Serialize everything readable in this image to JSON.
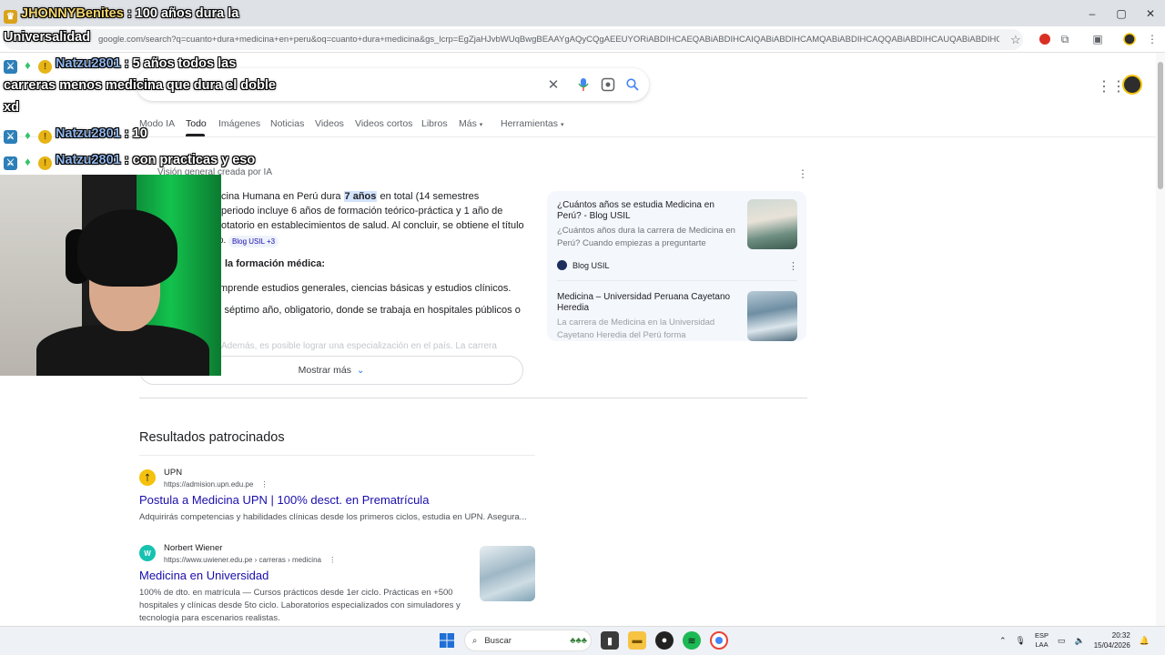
{
  "browser": {
    "url": "google.com/search?q=cuanto+dura+medicina+en+peru&oq=cuanto+dura+medicina&gs_lcrp=EgZjaHJvbWUqBwgBEAAYgAQyCQgAEEUYORiABDIHCAEQABiABDIHCAIQABiABDIHCAMQABiABDIHCAQQABiABDIHCAUQABiABDIHCAYQABiA...",
    "window_controls": [
      "–",
      "▢",
      "✕"
    ]
  },
  "google": {
    "tabs": [
      {
        "label": "Modo IA",
        "active": false
      },
      {
        "label": "Todo",
        "active": true
      },
      {
        "label": "Imágenes",
        "active": false
      },
      {
        "label": "Noticias",
        "active": false
      },
      {
        "label": "Videos",
        "active": false
      },
      {
        "label": "Videos cortos",
        "active": false
      },
      {
        "label": "Libros",
        "active": false
      },
      {
        "label": "Más",
        "active": false
      },
      {
        "label": "Herramientas",
        "active": false
      }
    ],
    "ai_overview": {
      "label": "Visión general creada por IA",
      "line1_pre": "cina Humana en Perú dura",
      "line1_highlight": "7 años",
      "line1_post": "en total (14 semestres",
      "line2": "periodo incluye 6 años de formación teórico-práctica y 1 año de",
      "line3": "otatorio en establecimientos de salud. Al concluir, se obtiene el título",
      "line4_frag": "o.",
      "chip": "Blog USIL +3",
      "section_heading": "la formación médica:",
      "bullet1": "mprende estudios generales, ciencias básicas y estudios clínicos.",
      "bullet2": "l séptimo año, obligatorio, donde se trabaja en hospitales públicos o",
      "fade_line": "Además, es posible lograr una especialización en el país. La carrera",
      "show_more": "Mostrar más"
    },
    "cards": [
      {
        "title": "¿Cuántos años se estudia Medicina en Perú? - Blog USIL",
        "snippet": "¿Cuántos años dura la carrera de Medicina en Perú? Cuando empiezas a preguntarte cuánto...",
        "source": "Blog USIL"
      },
      {
        "title": "Medicina – Universidad Peruana Cayetano Heredia",
        "snippet": "La carrera de Medicina en la Universidad Cayetano Heredia del Perú forma profesionales"
      }
    ],
    "sponsored": {
      "heading": "Resultados patrocinados",
      "ads": [
        {
          "name": "UPN",
          "url": "https://admision.upn.edu.pe",
          "title": "Postula a Medicina UPN | 100% desct. en Prematrícula",
          "desc": "Adquirirás competencias y habilidades clínicas desde los primeros ciclos, estudia en UPN. Asegura..."
        },
        {
          "name": "Norbert Wiener",
          "url": "https://www.uwiener.edu.pe › carreras › medicina",
          "title": "Medicina en Universidad",
          "desc": "100% de dto. en matrícula — Cursos prácticos desde 1er ciclo. Prácticas en +500 hospitales y clínicas desde 5to ciclo. Laboratorios especializados con simuladores y tecnología para escenarios realistas."
        }
      ]
    }
  },
  "chat": [
    {
      "user": "JHONNYBenites",
      "separator": ":",
      "text_line1": "100 años dura la",
      "text_line2": "Universalidad"
    },
    {
      "user": "Natzu2801",
      "separator": ":",
      "text_line1": "5 años todos las",
      "text_line2": "carreras menos medicina que dura el doble",
      "text_line3": "xd"
    },
    {
      "user": "Natzu2801",
      "separator": ":",
      "text_line1": "10"
    },
    {
      "user": "Natzu2801",
      "separator": ":",
      "text_line1": "con practicas y eso"
    }
  ],
  "taskbar": {
    "search_label": "Buscar",
    "lang_top": "ESP",
    "lang_bottom": "LAA",
    "time": "20:32",
    "date": "15/04/2026"
  },
  "colors": {
    "link": "#1a0dab",
    "highlight": "#d3e3fd",
    "card_bg": "#f4f7fc",
    "chat_user": "#8fb4e8"
  }
}
